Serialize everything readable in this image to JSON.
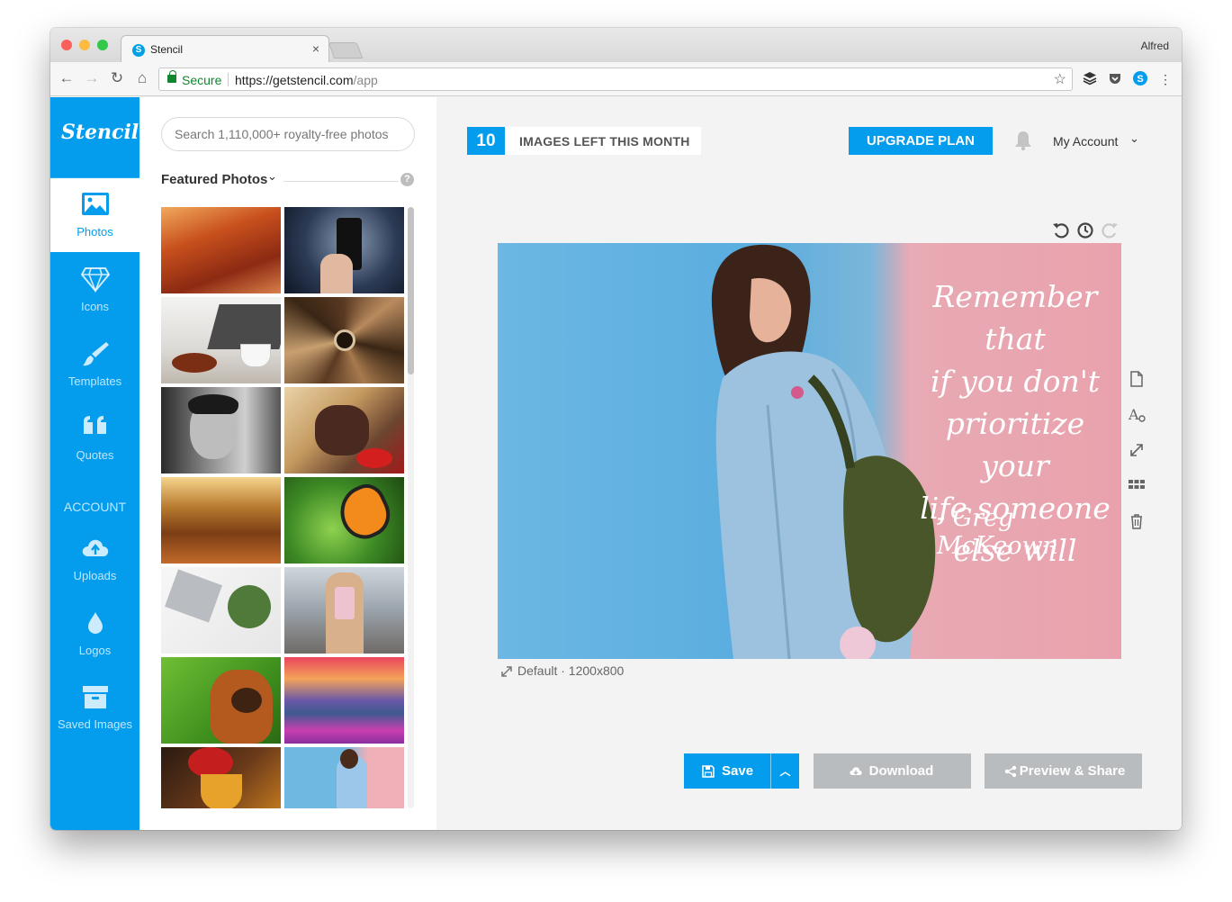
{
  "browser": {
    "tab_title": "Stencil",
    "tab_close": "×",
    "profile_name": "Alfred",
    "secure_label": "Secure",
    "url_base": "https://getstencil.com",
    "url_path": "/app"
  },
  "sidebar": {
    "logo": "Stencil",
    "items": [
      {
        "label": "Photos",
        "icon": "image-icon"
      },
      {
        "label": "Icons",
        "icon": "diamond-icon"
      },
      {
        "label": "Templates",
        "icon": "brush-icon"
      },
      {
        "label": "Quotes",
        "icon": "quote-icon"
      }
    ],
    "account_heading": "ACCOUNT",
    "account_items": [
      {
        "label": "Uploads",
        "icon": "cloud-upload-icon"
      },
      {
        "label": "Logos",
        "icon": "drop-icon"
      },
      {
        "label": "Saved Images",
        "icon": "archive-icon"
      }
    ]
  },
  "photos_panel": {
    "search_placeholder": "Search 1,110,000+ royalty-free photos",
    "featured_label": "Featured Photos",
    "help": "?"
  },
  "header": {
    "images_left": "10",
    "images_left_label": "IMAGES LEFT THIS MONTH",
    "upgrade_label": "UPGRADE PLAN",
    "account_label": "My Account"
  },
  "canvas": {
    "quote_lines": [
      "Remember that",
      "if you don't",
      "prioritize your",
      "life someone",
      "else will"
    ],
    "quote_author": "- Greg McKeown",
    "size_label": "Default · 1200x800"
  },
  "actions": {
    "save_label": "Save",
    "download_label": "Download",
    "preview_label": "Preview & Share"
  },
  "colors": {
    "brand": "#049ded",
    "disabled_button": "#b9bcbe",
    "secure_green": "#12852f"
  }
}
